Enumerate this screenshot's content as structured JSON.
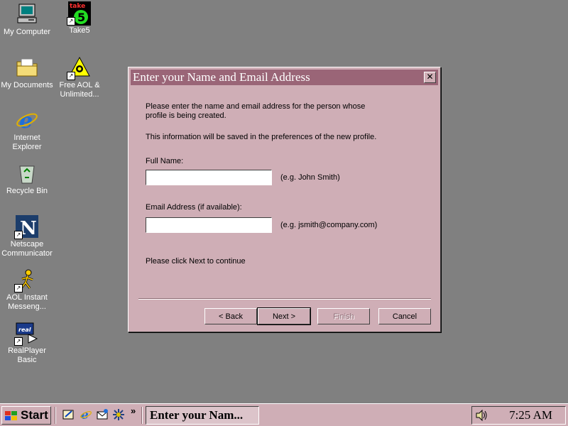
{
  "desktop": {
    "icons": [
      {
        "label": "My Computer"
      },
      {
        "label": "Take5"
      },
      {
        "label": "My Documents"
      },
      {
        "label": "Free AOL & Unlimited..."
      },
      {
        "label": "Internet Explorer"
      },
      {
        "label": "Recycle Bin"
      },
      {
        "label": "Netscape Communicator"
      },
      {
        "label": "AOL Instant Messeng..."
      },
      {
        "label": "RealPlayer Basic"
      }
    ],
    "take5_logo_text": "take"
  },
  "dialog": {
    "title": "Enter your Name and Email Address",
    "close_glyph": "✕",
    "intro_text": "Please enter the name and email address for the person whose profile is being created.",
    "info_text": "This information will be saved in the preferences of the new profile.",
    "full_name_label": "Full Name:",
    "full_name_value": "",
    "full_name_hint": "(e.g. John Smith)",
    "email_label": "Email Address (if available):",
    "email_value": "",
    "email_hint": "(e.g. jsmith@company.com)",
    "continue_text": "Please click Next to continue",
    "buttons": {
      "back": "< Back",
      "next": "Next >",
      "finish": "Finish",
      "cancel": "Cancel"
    }
  },
  "taskbar": {
    "start_label": "Start",
    "chevron": "»",
    "task_label": "Enter your Nam...",
    "clock": "7:25 AM"
  },
  "colors": {
    "desktop": "#808080",
    "face": "#cfaeb6",
    "titlebar": "#9a6577"
  }
}
